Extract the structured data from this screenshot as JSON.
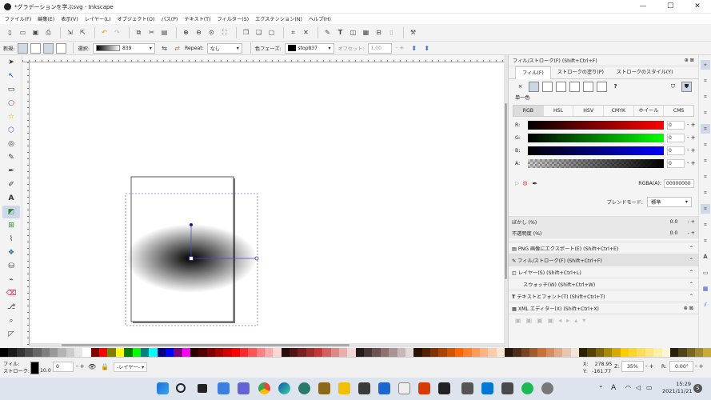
{
  "window": {
    "title": "*グラデーションを学ぶsvg - Inkscape",
    "minimize": "—",
    "maximize": "☐",
    "close": "✕"
  },
  "menu": [
    "ファイル(F)",
    "編集(E)",
    "表示(V)",
    "レイヤー(L)",
    "オブジェクト(O)",
    "パス(P)",
    "テキスト(T)",
    "フィルター(S)",
    "エクステンション(N)",
    "ヘルプ(H)"
  ],
  "context_toolbar": {
    "new_label": "新規:",
    "select_label": "選択:",
    "gradient_name": "839",
    "repeat_label": "Repeat:",
    "repeat_value": "なし",
    "stops_label": "色フェーズ:",
    "stop_name": "stop837",
    "offset_label": "オフセット:",
    "offset_value": "1.00"
  },
  "panel": {
    "header": "フィル/ストローク(F) (Shift+Ctrl+F)",
    "tabs": [
      "フィル(F)",
      "ストロークの塗り(P)",
      "ストロークのスタイル(Y)"
    ],
    "fill_type_label": "単一色",
    "fill_types": [
      "×",
      "?"
    ],
    "color_modes": [
      "RGB",
      "HSL",
      "HSV",
      "CMYK",
      "ホイール",
      "CMS"
    ],
    "channels": [
      {
        "label": "R:",
        "value": "0",
        "color": "#ff0000"
      },
      {
        "label": "G:",
        "value": "0",
        "color": "#00ff00"
      },
      {
        "label": "B:",
        "value": "0",
        "color": "#0000ff"
      },
      {
        "label": "A:",
        "value": "0",
        "color": "#000000"
      }
    ],
    "rgba_label": "RGBA(A):",
    "rgba_value": "00000000",
    "blend_label": "ブレンドモード:",
    "blend_value": "標準",
    "blur_label": "ぼかし (%)",
    "blur_value": "0.0",
    "opacity_label": "不透明度 (%)",
    "opacity_value": "0.0",
    "dock_items": [
      "PNG 画像にエクスポート(E) (Shift+Ctrl+E)",
      "フィル/ストローク(F) (Shift+Ctrl+F)",
      "レイヤー(S) (Shift+Ctrl+L)",
      "スウォッチ(W) (Shift+Ctrl+W)",
      "テキストとフォント(T) (Shift+Ctrl+T)",
      "XML エディター(X) (Shift+Ctrl+X)"
    ]
  },
  "status": {
    "fill_label": "フィル:",
    "stroke_label": "ストローク:",
    "stroke_width": "10.0",
    "opacity": "0",
    "layer": "-レイヤー-",
    "x_label": "X:",
    "x_value": "278.95",
    "y_label": "Y:",
    "y_value": "-161.77",
    "zoom_label": "Z:",
    "zoom_value": "35%",
    "rotate_label": "R:",
    "rotate_value": "0.00°"
  },
  "taskbar": {
    "time": "15:29",
    "date": "2021/11/21",
    "notification_count": "5"
  },
  "colors": {
    "accent": "#1a1aa0",
    "selection_dashed": "#3a3aa8"
  }
}
